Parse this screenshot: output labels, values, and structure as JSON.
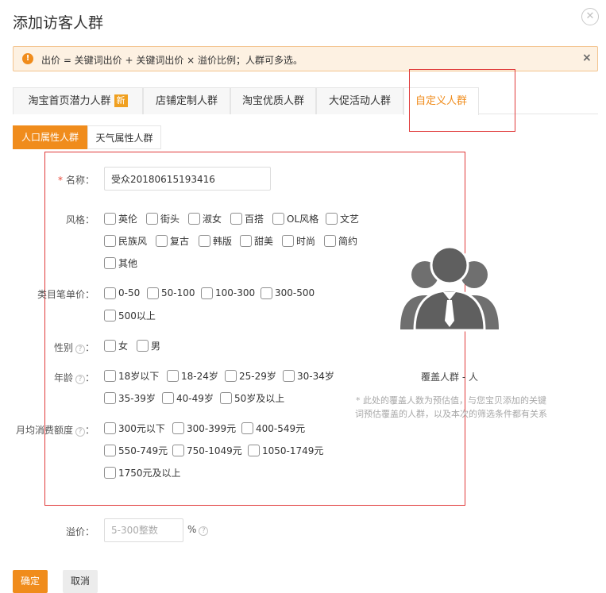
{
  "dialog": {
    "title": "添加访客人群",
    "close_icon": "close-icon"
  },
  "notice": {
    "icon": "warning-icon",
    "icon_glyph": "!",
    "text": "出价 = 关键词出价 + 关键词出价 × 溢价比例；人群可多选。",
    "close_glyph": "×"
  },
  "tabs": [
    {
      "label": "淘宝首页潜力人群",
      "badge": "新"
    },
    {
      "label": "店铺定制人群"
    },
    {
      "label": "淘宝优质人群"
    },
    {
      "label": "大促活动人群"
    },
    {
      "label": "自定义人群",
      "active": true
    }
  ],
  "subtabs": [
    {
      "label": "人口属性人群",
      "active": true
    },
    {
      "label": "天气属性人群"
    }
  ],
  "form": {
    "name": {
      "required_mark": "*",
      "label": "名称：",
      "value": "受众20180615193416"
    },
    "style": {
      "label": "风格：",
      "options": [
        "英伦",
        "街头",
        "淑女",
        "百搭",
        "OL风格",
        "文艺",
        "民族风",
        "复古",
        "韩版",
        "甜美",
        "时尚",
        "简约",
        "其他"
      ]
    },
    "price": {
      "label": "类目笔单价：",
      "options": [
        "0-50",
        "50-100",
        "100-300",
        "300-500",
        "500以上"
      ]
    },
    "gender": {
      "label": "性别",
      "options": [
        "女",
        "男"
      ]
    },
    "age": {
      "label": "年龄",
      "options": [
        "18岁以下",
        "18-24岁",
        "25-29岁",
        "30-34岁",
        "35-39岁",
        "40-49岁",
        "50岁及以上"
      ]
    },
    "spend": {
      "label": "月均消费额度",
      "options": [
        "300元以下",
        "300-399元",
        "400-549元",
        "550-749元",
        "750-1049元",
        "1050-1749元",
        "1750元及以上"
      ]
    },
    "premium": {
      "label": "溢价：",
      "placeholder": "5-300整数",
      "unit": "%"
    },
    "help_glyph": "?",
    "colon": "："
  },
  "coverage": {
    "icon": "user-group-icon",
    "text": "覆盖人群 - 人",
    "note": "* 此处的覆盖人数为预估值，与您宝贝添加的关键词预估覆盖的人群，以及本次的筛选条件都有关系"
  },
  "buttons": {
    "ok": "确定",
    "cancel": "取消"
  },
  "colors": {
    "accent": "#f08c1c",
    "highlight_box": "#e03a3a",
    "notice_bg": "#fdf1e2"
  }
}
